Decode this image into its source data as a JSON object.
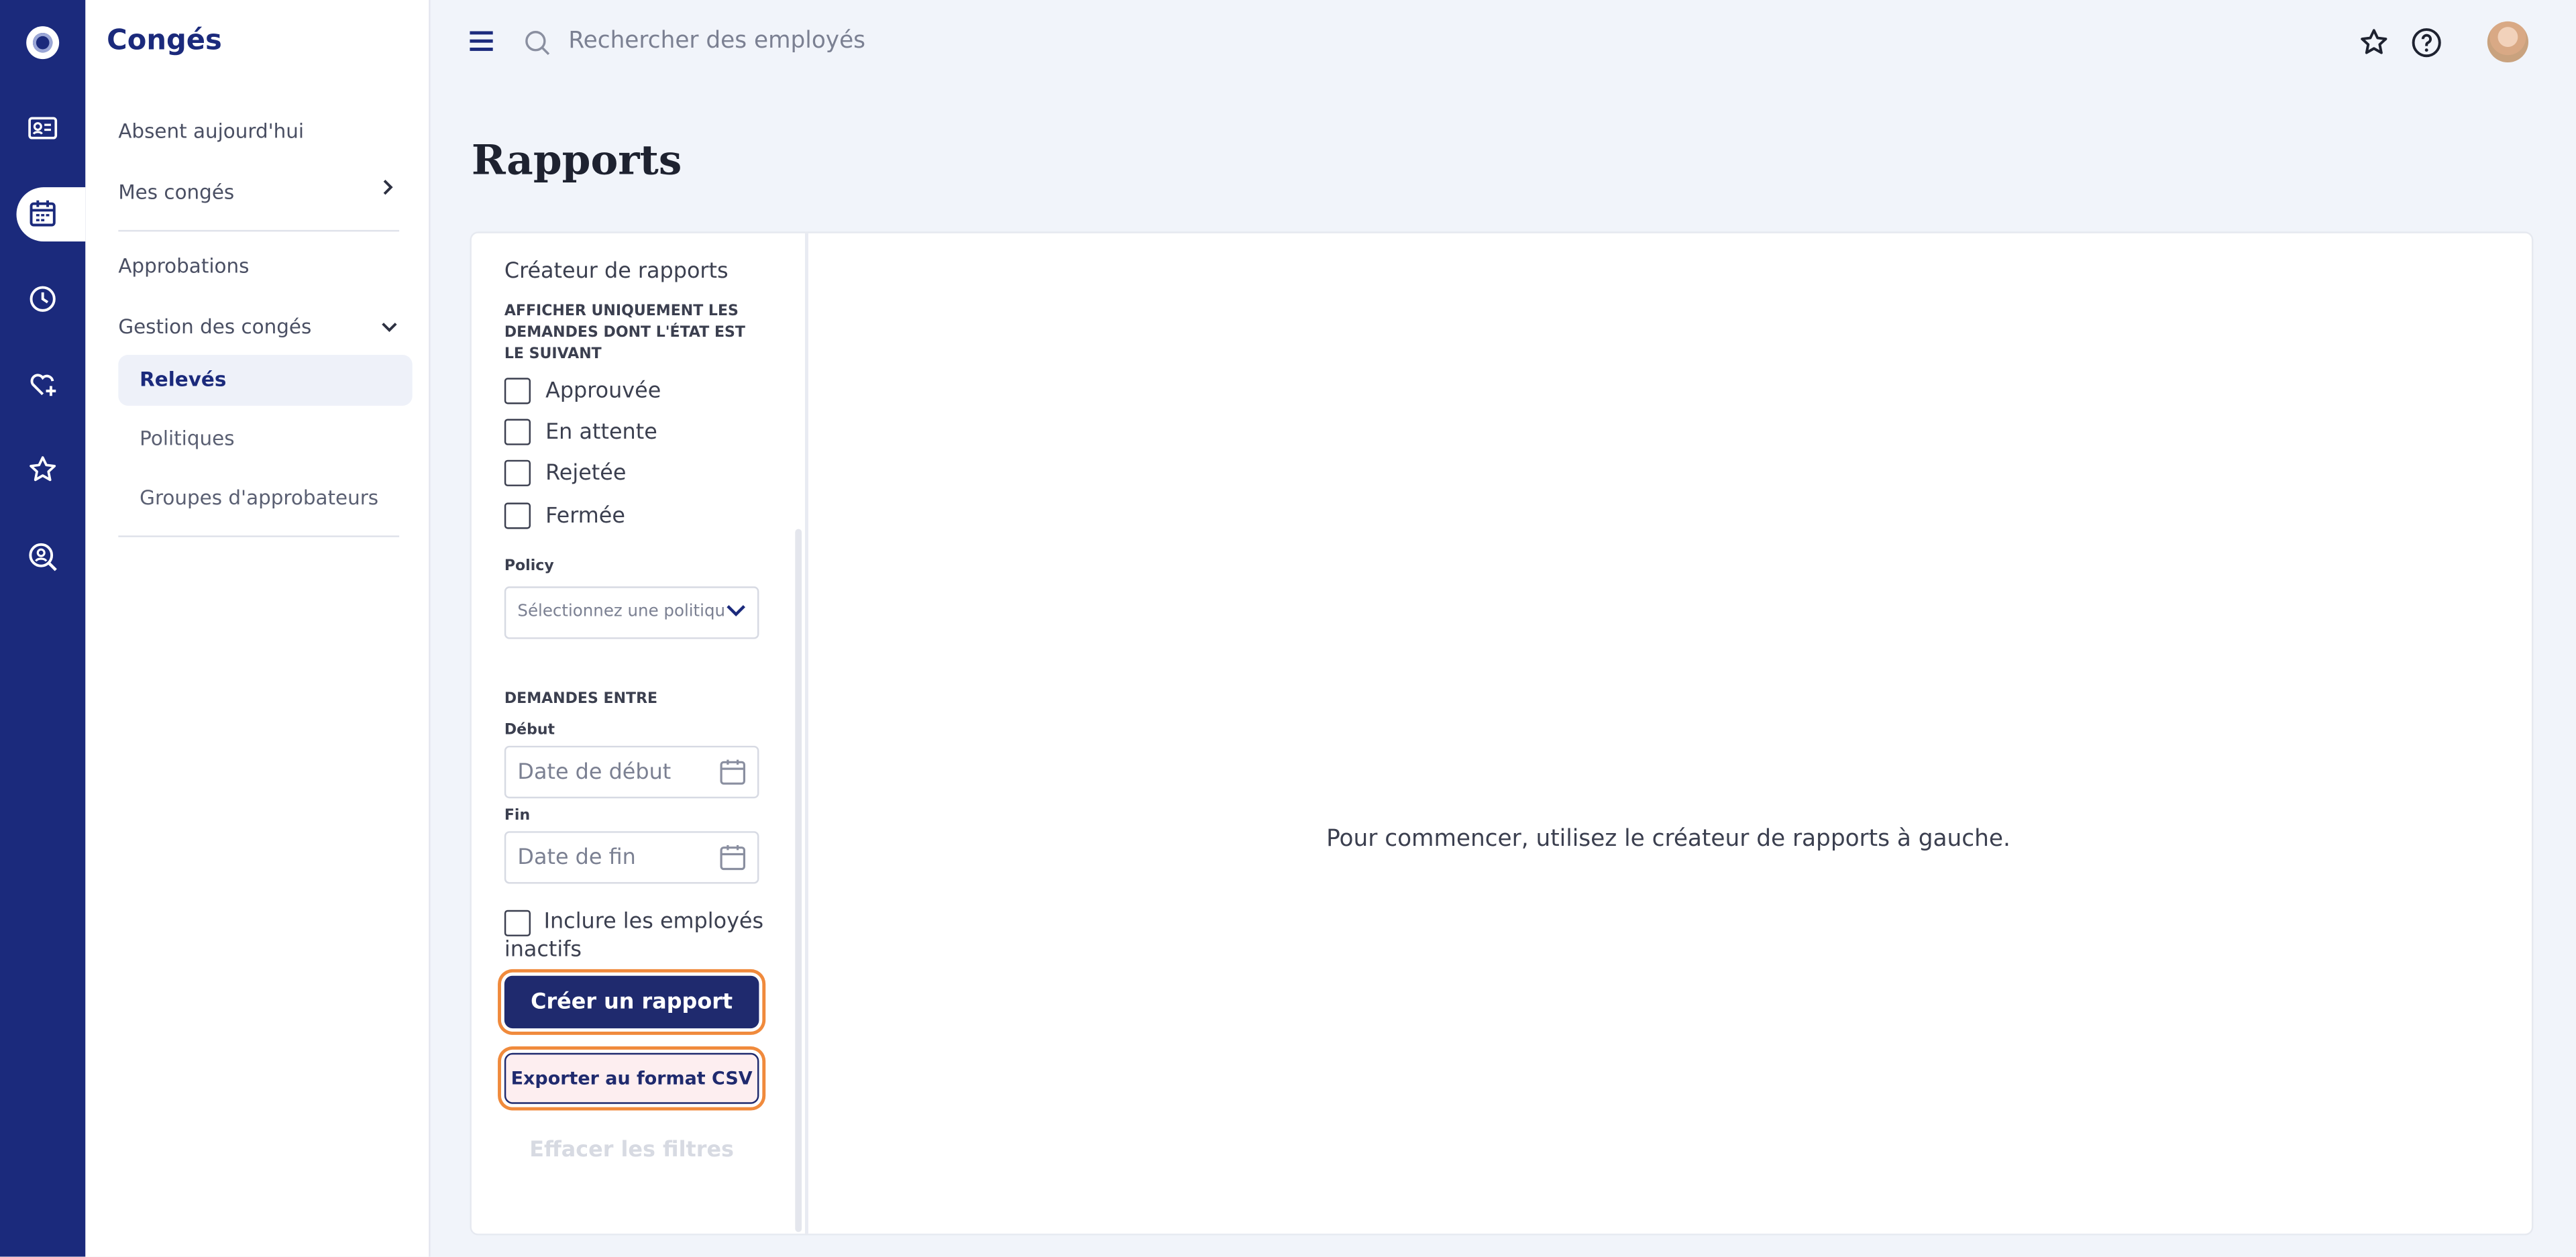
{
  "nav": {
    "app_title": "Congés",
    "rail_icons": [
      "logo-icon",
      "contact-card-icon",
      "calendar-icon",
      "clock-icon",
      "heart-plus-icon",
      "star-icon",
      "search-person-icon"
    ]
  },
  "sidebar": {
    "items": [
      {
        "label": "Absent aujourd'hui"
      },
      {
        "label": "Mes congés"
      },
      {
        "label": "Approbations"
      },
      {
        "label": "Gestion des congés"
      }
    ],
    "subitems": [
      {
        "label": "Relevés"
      },
      {
        "label": "Politiques"
      },
      {
        "label": "Groupes d'approbateurs"
      }
    ]
  },
  "topbar": {
    "search_placeholder": "Rechercher des employés"
  },
  "page": {
    "title": "Rapports"
  },
  "builder": {
    "title": "Créateur de rapports",
    "status_label": "AFFICHER UNIQUEMENT LES DEMANDES DONT L'ÉTAT EST LE SUIVANT",
    "statuses": [
      "Approuvée",
      "En attente",
      "Rejetée",
      "Fermée"
    ],
    "policy_label": "Policy",
    "policy_placeholder": "Sélectionnez une politique",
    "range_label": "DEMANDES ENTRE",
    "start_label": "Début",
    "start_placeholder": "Date de début",
    "end_label": "Fin",
    "end_placeholder": "Date de fin",
    "inactive_label": "Inclure les employés inactifs",
    "create_label": "Créer un rapport",
    "export_label": "Exporter au format CSV",
    "clear_label": "Effacer les filtres"
  },
  "results": {
    "empty_message": "Pour commencer, utilisez le créateur de rapports à gauche."
  },
  "colors": {
    "rail": "#1b2a7c",
    "primary_button": "#1f2a6e",
    "focus_outline": "#f08a3c",
    "background": "#f1f4fa"
  }
}
